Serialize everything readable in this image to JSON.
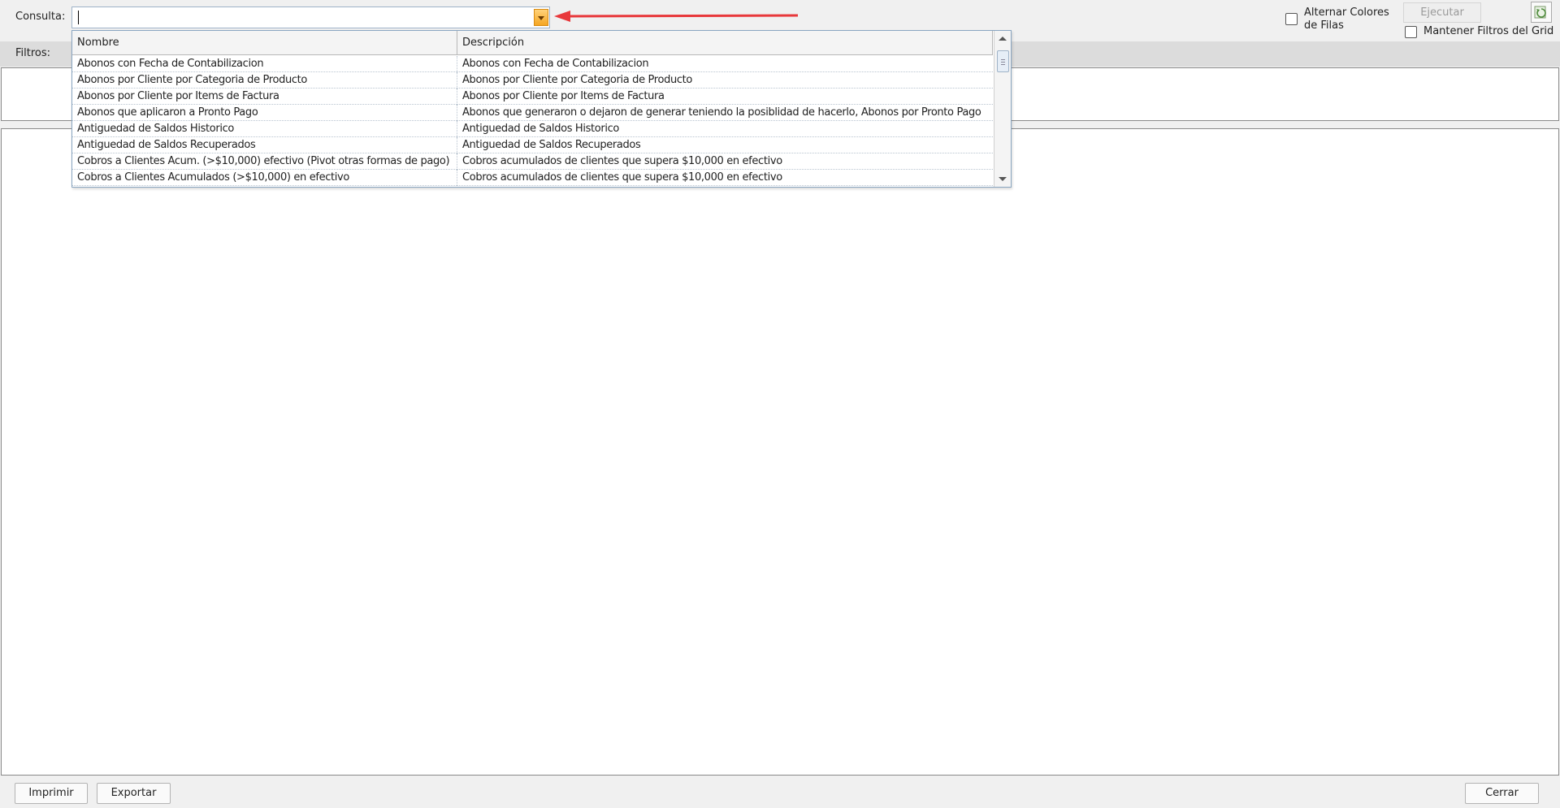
{
  "query": {
    "label": "Consulta:",
    "value": "",
    "dropdown_icon": "chevron-down-icon"
  },
  "options": {
    "alternate_rows_label": "Alternar Colores de Filas",
    "alternate_rows_checked": false,
    "keep_filters_label": "Mantener Filtros del Grid",
    "keep_filters_checked": false,
    "execute_label": "Ejecutar",
    "refresh_icon": "refresh-icon"
  },
  "filters": {
    "label": "Filtros:"
  },
  "dropdown": {
    "columns": [
      "Nombre",
      "Descripción"
    ],
    "rows": [
      {
        "nombre": "Abonos con Fecha de Contabilizacion",
        "descripcion": "Abonos con Fecha de Contabilizacion"
      },
      {
        "nombre": "Abonos por Cliente por Categoria de Producto",
        "descripcion": "Abonos por Cliente por Categoria de Producto"
      },
      {
        "nombre": "Abonos por Cliente por Items de Factura",
        "descripcion": "Abonos por Cliente por Items de Factura"
      },
      {
        "nombre": "Abonos que aplicaron a Pronto Pago",
        "descripcion": "Abonos que generaron o dejaron de generar teniendo la posiblidad de hacerlo, Abonos por Pronto Pago"
      },
      {
        "nombre": "Antiguedad de Saldos Historico",
        "descripcion": "Antiguedad de Saldos Historico"
      },
      {
        "nombre": "Antiguedad de Saldos Recuperados",
        "descripcion": "Antiguedad de Saldos Recuperados"
      },
      {
        "nombre": "Cobros a Clientes Acum. (>$10,000) efectivo (Pivot otras formas de pago)",
        "descripcion": "Cobros acumulados de clientes que supera $10,000 en efectivo"
      },
      {
        "nombre": "Cobros a Clientes Acumulados (>$10,000)  en efectivo",
        "descripcion": "Cobros acumulados de clientes que supera $10,000 en efectivo"
      }
    ]
  },
  "footer": {
    "print_label": "Imprimir",
    "export_label": "Exportar",
    "close_label": "Cerrar"
  },
  "colors": {
    "annotation_arrow": "#e8383b",
    "combo_button": "#f5a623",
    "combo_border": "#9fb3c8"
  }
}
